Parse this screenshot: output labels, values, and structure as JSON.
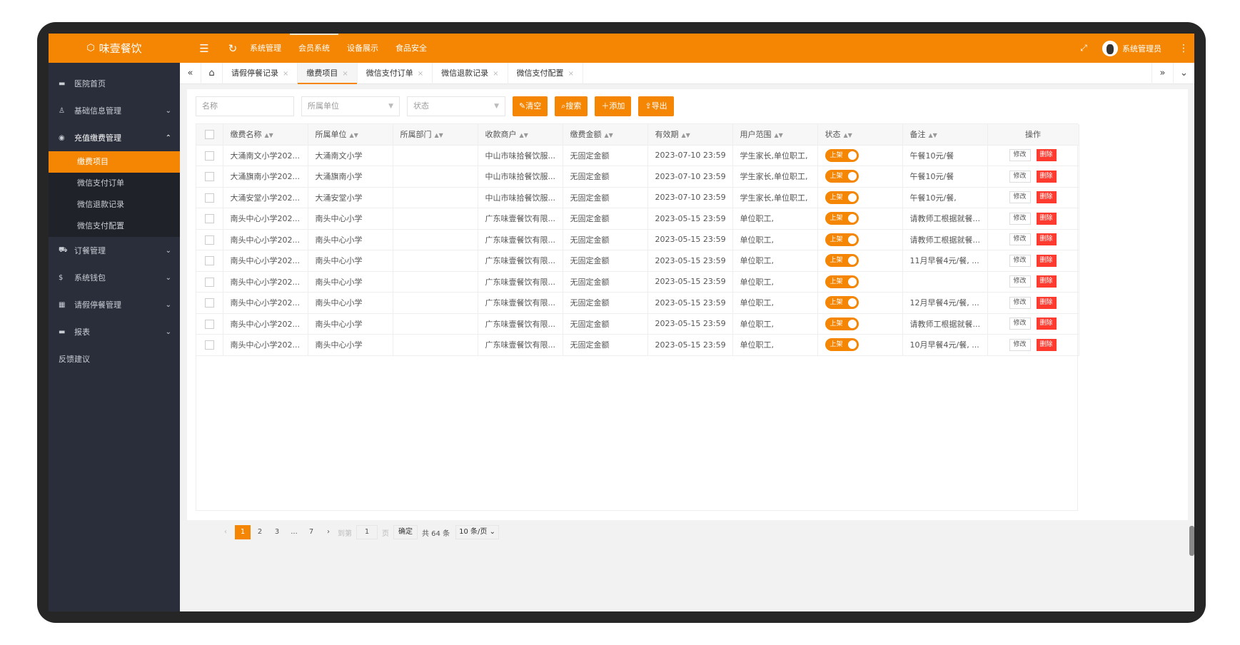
{
  "brand": {
    "name": "味壹餐饮",
    "icon": "cube-icon"
  },
  "topnav": {
    "items": [
      "系统管理",
      "会员系统",
      "设备展示",
      "食品安全"
    ],
    "active": 1
  },
  "user": {
    "name": "系统管理员"
  },
  "sidebar": {
    "items": [
      {
        "label": "医院首页",
        "icon": "monitor-icon"
      },
      {
        "label": "基础信息管理",
        "icon": "user-icon"
      },
      {
        "label": "充值缴费管理",
        "icon": "settings-icon"
      },
      {
        "label": "订餐管理",
        "icon": "cart-icon"
      },
      {
        "label": "系统钱包",
        "icon": "dollar-icon"
      },
      {
        "label": "请假停餐管理",
        "icon": "calendar-icon"
      },
      {
        "label": "报表",
        "icon": "monitor-icon"
      },
      {
        "label": "反馈建议",
        "icon": ""
      }
    ],
    "subitems": [
      "缴费项目",
      "微信支付订单",
      "微信退款记录",
      "微信支付配置"
    ]
  },
  "tabs": [
    "请假停餐记录",
    "缴费项目",
    "微信支付订单",
    "微信退款记录",
    "微信支付配置"
  ],
  "filters": {
    "name_placeholder": "名称",
    "unit_placeholder": "所属单位",
    "status_placeholder": "状态",
    "clear": "清空",
    "search": "搜索",
    "add": "添加",
    "export": "导出"
  },
  "table": {
    "headers": [
      "缴费名称",
      "所属单位",
      "所属部门",
      "收款商户",
      "缴费金额",
      "有效期",
      "用户范围",
      "状态",
      "备注",
      "操作"
    ],
    "status_label": "上架",
    "edit_label": "修改",
    "delete_label": "删除",
    "rows": [
      [
        "大涌南文小学202...",
        "大涌南文小学",
        "",
        "中山市味拾餐饮服...",
        "无固定金额",
        "2023-07-10 23:59",
        "学生家长,单位职工,",
        "午餐10元/餐"
      ],
      [
        "大涌旗南小学202...",
        "大涌旗南小学",
        "",
        "中山市味拾餐饮服...",
        "无固定金额",
        "2023-07-10 23:59",
        "学生家长,单位职工,",
        "午餐10元/餐"
      ],
      [
        "大涌安堂小学202...",
        "大涌安堂小学",
        "",
        "中山市味拾餐饮服...",
        "无固定金额",
        "2023-07-10 23:59",
        "学生家长,单位职工,",
        "午餐10元/餐,"
      ],
      [
        "南头中心小学202...",
        "南头中心小学",
        "",
        "广东味壹餐饮有限...",
        "无固定金额",
        "2023-05-15 23:59",
        "单位职工,",
        "请教师工根据就餐..."
      ],
      [
        "南头中心小学202...",
        "南头中心小学",
        "",
        "广东味壹餐饮有限...",
        "无固定金额",
        "2023-05-15 23:59",
        "单位职工,",
        "请教师工根据就餐..."
      ],
      [
        "南头中心小学202...",
        "南头中心小学",
        "",
        "广东味壹餐饮有限...",
        "无固定金额",
        "2023-05-15 23:59",
        "单位职工,",
        "11月早餐4元/餐, ..."
      ],
      [
        "南头中心小学202...",
        "南头中心小学",
        "",
        "广东味壹餐饮有限...",
        "无固定金额",
        "2023-05-15 23:59",
        "单位职工,",
        ""
      ],
      [
        "南头中心小学202...",
        "南头中心小学",
        "",
        "广东味壹餐饮有限...",
        "无固定金额",
        "2023-05-15 23:59",
        "单位职工,",
        "12月早餐4元/餐, ..."
      ],
      [
        "南头中心小学202...",
        "南头中心小学",
        "",
        "广东味壹餐饮有限...",
        "无固定金额",
        "2023-05-15 23:59",
        "单位职工,",
        "请教师工根据就餐..."
      ],
      [
        "南头中心小学202...",
        "南头中心小学",
        "",
        "广东味壹餐饮有限...",
        "无固定金额",
        "2023-05-15 23:59",
        "单位职工,",
        "10月早餐4元/餐, ..."
      ]
    ]
  },
  "pager": {
    "pages": [
      "1",
      "2",
      "3",
      "...",
      "7"
    ],
    "goto_label": "到第",
    "goto_value": "1",
    "page_unit": "页",
    "confirm": "确定",
    "total": "共 64 条",
    "page_size": "10 条/页"
  },
  "colors": {
    "accent": "#f48604",
    "sidebar": "#2a2e3a",
    "danger": "#ff3b30"
  }
}
